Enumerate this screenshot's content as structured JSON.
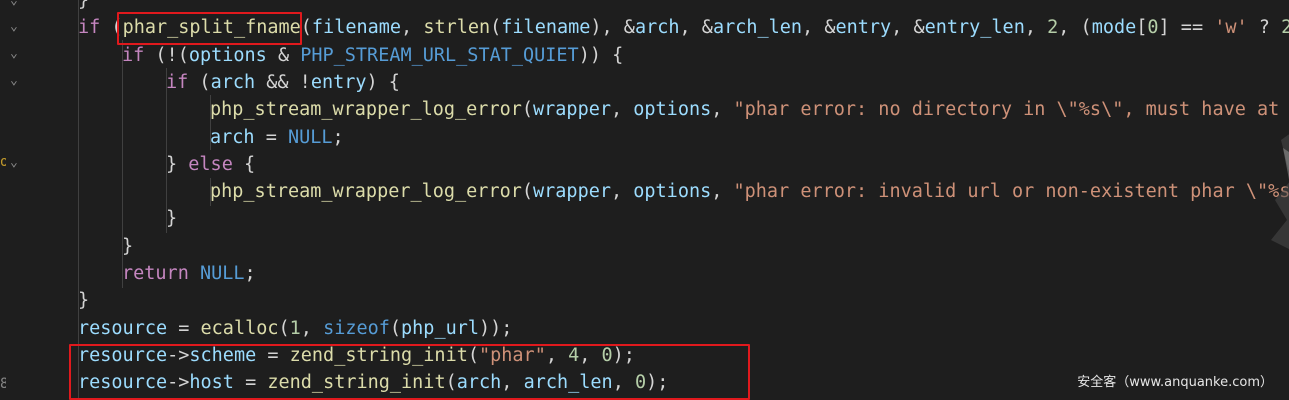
{
  "editor": {
    "language": "c",
    "lines": [
      {
        "indent": 1,
        "tokens": [
          [
            "pn",
            "}"
          ]
        ]
      },
      {
        "indent": 1,
        "tokens": [
          [
            "kw",
            "if"
          ],
          [
            "pn",
            " ("
          ],
          [
            "fn",
            "phar_split_fname"
          ],
          [
            "pn",
            "("
          ],
          [
            "var",
            "filename"
          ],
          [
            "pn",
            ", "
          ],
          [
            "fn",
            "strlen"
          ],
          [
            "pn",
            "("
          ],
          [
            "var",
            "filename"
          ],
          [
            "pn",
            "), &"
          ],
          [
            "var",
            "arch"
          ],
          [
            "pn",
            ", &"
          ],
          [
            "var",
            "arch_len"
          ],
          [
            "pn",
            ", &"
          ],
          [
            "var",
            "entry"
          ],
          [
            "pn",
            ", &"
          ],
          [
            "var",
            "entry_len"
          ],
          [
            "pn",
            ", "
          ],
          [
            "num",
            "2"
          ],
          [
            "pn",
            ", ("
          ],
          [
            "var",
            "mode"
          ],
          [
            "pn",
            "["
          ],
          [
            "num",
            "0"
          ],
          [
            "pn",
            "] == "
          ],
          [
            "str",
            "'w'"
          ],
          [
            "pn",
            " ? "
          ],
          [
            "num",
            "2"
          ]
        ]
      },
      {
        "indent": 2,
        "tokens": [
          [
            "kw",
            "if"
          ],
          [
            "pn",
            " (!("
          ],
          [
            "var",
            "options"
          ],
          [
            "pn",
            " & "
          ],
          [
            "mac",
            "PHP_STREAM_URL_STAT_QUIET"
          ],
          [
            "pn",
            ")) {"
          ]
        ]
      },
      {
        "indent": 3,
        "tokens": [
          [
            "kw",
            "if"
          ],
          [
            "pn",
            " ("
          ],
          [
            "var",
            "arch"
          ],
          [
            "pn",
            " && !"
          ],
          [
            "var",
            "entry"
          ],
          [
            "pn",
            ") {"
          ]
        ]
      },
      {
        "indent": 4,
        "tokens": [
          [
            "fn",
            "php_stream_wrapper_log_error"
          ],
          [
            "pn",
            "("
          ],
          [
            "var",
            "wrapper"
          ],
          [
            "pn",
            ", "
          ],
          [
            "var",
            "options"
          ],
          [
            "pn",
            ", "
          ],
          [
            "str",
            "\"phar error: no directory in \\\"%s\\\", must have at l"
          ]
        ]
      },
      {
        "indent": 4,
        "tokens": [
          [
            "var",
            "arch"
          ],
          [
            "pn",
            " = "
          ],
          [
            "con",
            "NULL"
          ],
          [
            "pn",
            ";"
          ]
        ]
      },
      {
        "indent": 3,
        "tokens": [
          [
            "pn",
            "} "
          ],
          [
            "kw",
            "else"
          ],
          [
            "pn",
            " {"
          ]
        ]
      },
      {
        "indent": 4,
        "tokens": [
          [
            "fn",
            "php_stream_wrapper_log_error"
          ],
          [
            "pn",
            "("
          ],
          [
            "var",
            "wrapper"
          ],
          [
            "pn",
            ", "
          ],
          [
            "var",
            "options"
          ],
          [
            "pn",
            ", "
          ],
          [
            "str",
            "\"phar error: invalid url or non-existent phar \\\"%s\\"
          ]
        ]
      },
      {
        "indent": 3,
        "tokens": [
          [
            "pn",
            "}"
          ]
        ]
      },
      {
        "indent": 2,
        "tokens": [
          [
            "pn",
            "}"
          ]
        ]
      },
      {
        "indent": 2,
        "tokens": [
          [
            "kw",
            "return"
          ],
          [
            "pn",
            " "
          ],
          [
            "con",
            "NULL"
          ],
          [
            "pn",
            ";"
          ]
        ]
      },
      {
        "indent": 1,
        "tokens": [
          [
            "pn",
            "}"
          ]
        ]
      },
      {
        "indent": 1,
        "tokens": [
          [
            "var",
            "resource"
          ],
          [
            "pn",
            " = "
          ],
          [
            "fn",
            "ecalloc"
          ],
          [
            "pn",
            "("
          ],
          [
            "num",
            "1"
          ],
          [
            "pn",
            ", "
          ],
          [
            "con",
            "sizeof"
          ],
          [
            "pn",
            "("
          ],
          [
            "var",
            "php_url"
          ],
          [
            "pn",
            "));"
          ]
        ]
      },
      {
        "indent": 1,
        "tokens": [
          [
            "var",
            "resource"
          ],
          [
            "pn",
            "->"
          ],
          [
            "var",
            "scheme"
          ],
          [
            "pn",
            " = "
          ],
          [
            "fn",
            "zend_string_init"
          ],
          [
            "pn",
            "("
          ],
          [
            "str",
            "\"phar\""
          ],
          [
            "pn",
            ", "
          ],
          [
            "num",
            "4"
          ],
          [
            "pn",
            ", "
          ],
          [
            "num",
            "0"
          ],
          [
            "pn",
            ");"
          ]
        ]
      },
      {
        "indent": 1,
        "tokens": [
          [
            "var",
            "resource"
          ],
          [
            "pn",
            "->"
          ],
          [
            "var",
            "host"
          ],
          [
            "pn",
            " = "
          ],
          [
            "fn",
            "zend_string_init"
          ],
          [
            "pn",
            "("
          ],
          [
            "var",
            "arch"
          ],
          [
            "pn",
            ", "
          ],
          [
            "var",
            "arch_len"
          ],
          [
            "pn",
            ", "
          ],
          [
            "num",
            "0"
          ],
          [
            "pn",
            ");"
          ]
        ]
      }
    ]
  },
  "gutter": {
    "fold_markers": [
      "chevron-down-icon",
      "chevron-down-icon",
      "chevron-down-icon",
      "chevron-down-icon",
      "chevron-down-icon"
    ],
    "line_fragments": [
      "o",
      "8"
    ]
  },
  "watermark": "安全客（www.anquanke.com）"
}
